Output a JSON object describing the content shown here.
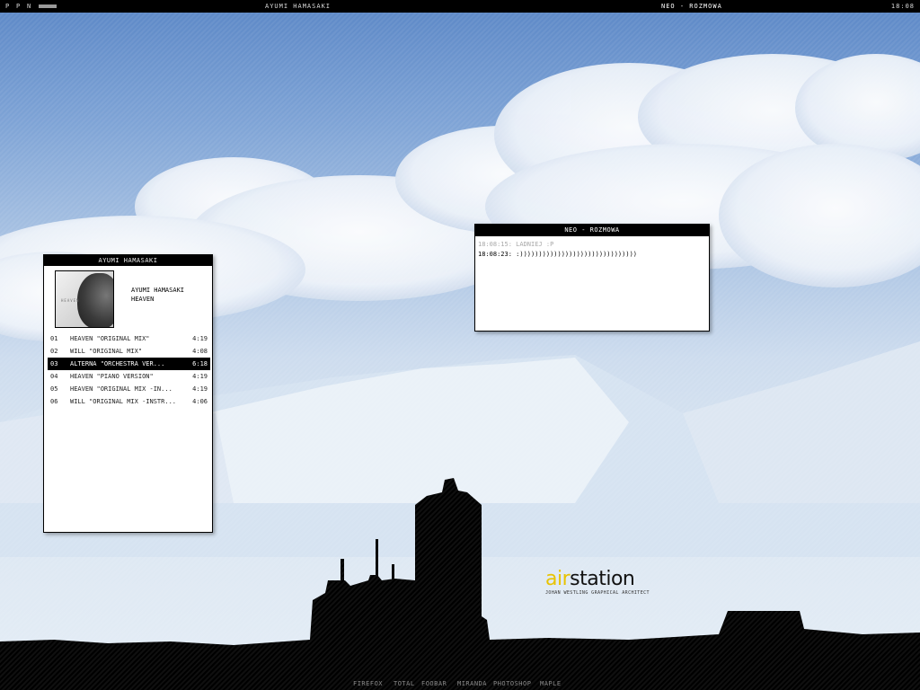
{
  "topbar": {
    "controls": [
      "P",
      "P",
      "N"
    ],
    "track": "Ayumi Hamasaki",
    "active_window": "Neo - Rozmowa",
    "clock": "18:08"
  },
  "player": {
    "title": "Ayumi Hamasaki",
    "artist": "Ayumi Hamasaki",
    "album": "Heaven",
    "cover_text": "HEAVEN",
    "tracks": [
      {
        "num": "01",
        "title": "Heaven \"original mix\"",
        "dur": "4:19"
      },
      {
        "num": "02",
        "title": "Will \"original mix\"",
        "dur": "4:08"
      },
      {
        "num": "03",
        "title": "Alterna \"orchestra ver...",
        "dur": "6:18"
      },
      {
        "num": "04",
        "title": "Heaven \"piano version\"",
        "dur": "4:19"
      },
      {
        "num": "05",
        "title": "Heaven \"original mix -in...",
        "dur": "4:19"
      },
      {
        "num": "06",
        "title": "Will \"original mix -instr...",
        "dur": "4:06"
      }
    ]
  },
  "chat": {
    "title": "Neo - Rozmowa",
    "messages": [
      {
        "text": "18:08:15: Ladniej :P"
      },
      {
        "text": "18:08:23: :)))))))))))))))))))))))))))))))"
      }
    ]
  },
  "logo": {
    "air": "air",
    "station": "station",
    "subtitle": "Johan Westling graphical architect"
  },
  "taskbar": [
    "firefox",
    "total",
    "foobar",
    "miranda",
    "photoshop",
    "maple"
  ],
  "colors": {
    "accent": "#e8c300",
    "bar": "#000000",
    "sky_top": "#5b87c6",
    "sky_bottom": "#e4edf6"
  }
}
